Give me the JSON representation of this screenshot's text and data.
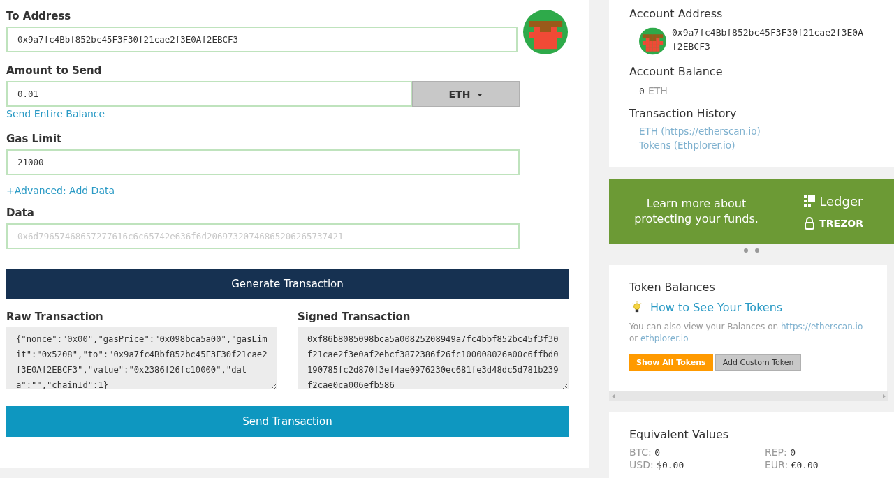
{
  "send_form": {
    "to_address": {
      "label": "To Address",
      "value": "0x9a7fc4Bbf852bc45F3F30f21cae2f3E0Af2EBCF3"
    },
    "amount": {
      "label": "Amount to Send",
      "value": "0.01",
      "unit": "ETH",
      "link": "Send Entire Balance"
    },
    "gas_limit": {
      "label": "Gas Limit",
      "value": "21000"
    },
    "advanced_link": "+Advanced: Add Data",
    "data": {
      "label": "Data",
      "placeholder": "0x6d79657468657277616c6c65742e636f6d20697320746865206265737421"
    },
    "generate_button": "Generate Transaction",
    "raw_transaction": {
      "label": "Raw Transaction",
      "value": "{\"nonce\":\"0x00\",\"gasPrice\":\"0x098bca5a00\",\"gasLimit\":\"0x5208\",\"to\":\"0x9a7fc4Bbf852bc45F3F30f21cae2f3E0Af2EBCF3\",\"value\":\"0x2386f26fc10000\",\"data\":\"\",\"chainId\":1}"
    },
    "signed_transaction": {
      "label": "Signed Transaction",
      "value": "0xf86b8085098bca5a00825208949a7fc4bbf852bc45f3f30f21cae2f3e0af2ebcf3872386f26fc100008026a00c6ffbd0190785fc2d870f3ef4ae0976230ec681fe3d48dc5d781b239f2cae0ca006efb586"
    },
    "send_button": "Send Transaction"
  },
  "account": {
    "address_title": "Account Address",
    "address": "0x9a7fc4Bbf852bc45F3F30f21cae2f3E0Af2EBCF3",
    "balance_title": "Account Balance",
    "balance_value": "0",
    "balance_unit": "ETH",
    "history_title": "Transaction History",
    "history_links": [
      "ETH (https://etherscan.io)",
      "Tokens (Ethplorer.io)"
    ]
  },
  "banner": {
    "text": "Learn more about protecting your funds.",
    "brands": [
      "Ledger",
      "TREZOR"
    ]
  },
  "tokens": {
    "title": "Token Balances",
    "help_link": "How to See Your Tokens",
    "note_prefix": "You can also view your Balances on",
    "note_link_1": "https://etherscan.io",
    "note_mid": "or",
    "note_link_2": "ethplorer.io",
    "buttons": [
      {
        "label": "Show All Tokens",
        "kind": "primary"
      },
      {
        "label": "Add Custom Token",
        "kind": "secondary"
      }
    ]
  },
  "equivalent": {
    "title": "Equivalent Values",
    "values": [
      {
        "label": "BTC:",
        "value": "0"
      },
      {
        "label": "REP:",
        "value": "0"
      },
      {
        "label": "USD:",
        "value": "$0.00"
      },
      {
        "label": "EUR:",
        "value": "€0.00"
      }
    ]
  }
}
